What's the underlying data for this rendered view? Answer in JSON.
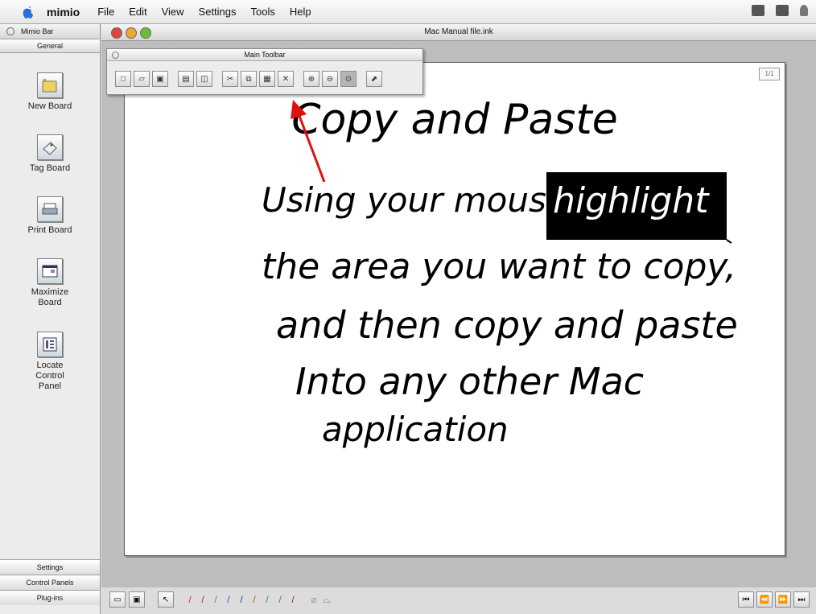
{
  "menubar": {
    "app_name": "mimio",
    "menus": [
      "File",
      "Edit",
      "View",
      "Settings",
      "Tools",
      "Help"
    ]
  },
  "mimio_bar": {
    "title": "Mimio Bar",
    "section": "General",
    "tools": [
      {
        "label": "New Board",
        "icon": "new-board-icon"
      },
      {
        "label": "Tag Board",
        "icon": "tag-board-icon"
      },
      {
        "label": "Print Board",
        "icon": "printer-icon"
      },
      {
        "label": "Maximize Board",
        "icon": "maximize-icon"
      },
      {
        "label": "Locate Control Panel",
        "icon": "control-panel-icon"
      }
    ],
    "bottom_sections": [
      "Settings",
      "Control Panels",
      "Plug-ins"
    ]
  },
  "window": {
    "title": "Mac Manual file.ink"
  },
  "main_toolbar": {
    "title": "Main Toolbar"
  },
  "board": {
    "lines": [
      "Copy and Paste",
      "Using your mouse,",
      "highlight",
      "the area you want to copy,",
      "and then copy and paste",
      "Into any other Mac",
      "application"
    ]
  },
  "colors": {
    "annotation_arrow": "#e01010",
    "highlight_bg": "#000000",
    "highlight_text": "#ffffff"
  }
}
